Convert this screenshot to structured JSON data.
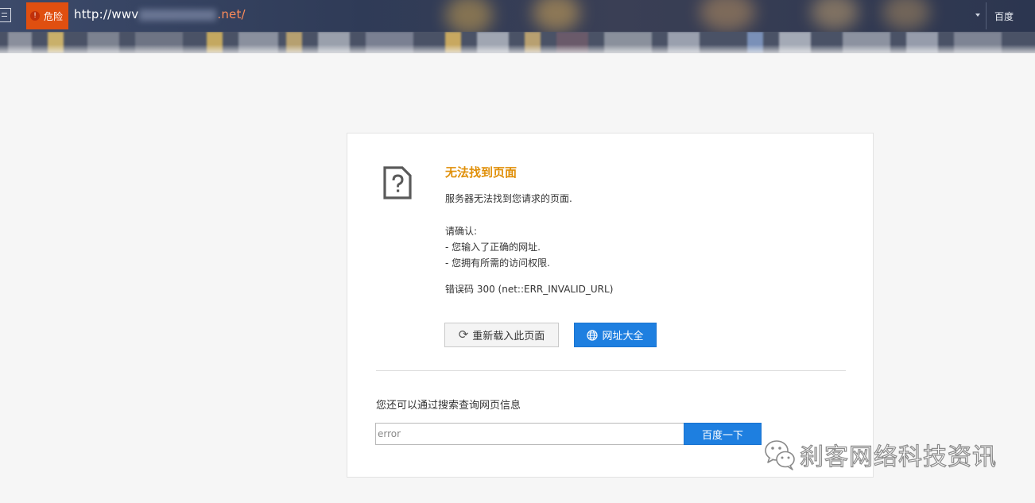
{
  "browser": {
    "security_badge": "危险",
    "url_prefix": "http://wwv",
    "url_suffix": ".net/",
    "search_engine": "百度"
  },
  "error_page": {
    "title": "无法找到页面",
    "description": "服务器无法找到您请求的页面.",
    "confirm_heading": "请确认:",
    "confirm_items": [
      "- 您输入了正确的网址.",
      "- 您拥有所需的访问权限."
    ],
    "error_code": "错误码 300 (net::ERR_INVALID_URL)",
    "reload_button": "重新载入此页面",
    "directory_button": "网址大全",
    "search_hint": "您还可以通过搜索查询网页信息",
    "search_value": "error",
    "search_button": "百度一下",
    "title_color": "#e0900a",
    "accent_color": "#1e7fe0",
    "danger_color": "#e04f10"
  },
  "watermark": {
    "text": "刹客网络科技资讯"
  }
}
